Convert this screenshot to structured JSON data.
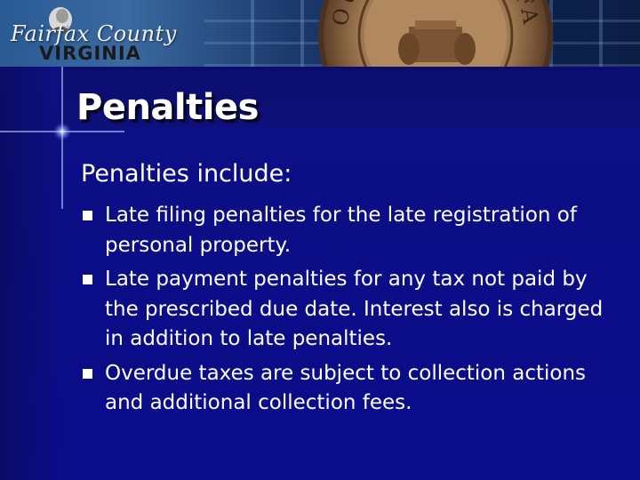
{
  "header": {
    "logo": {
      "line1": "Fairfax County",
      "line2": "VIRGINIA"
    },
    "seal_text": "COUNTY OF FAIRFAX"
  },
  "slide": {
    "title": "Penalties",
    "intro": "Penalties include:",
    "bullets": [
      {
        "text": "Late filing penalties for the late registration of personal property."
      },
      {
        "text": "Late payment penalties for any tax not paid by the prescribed due date. Interest also is charged in addition to late penalties."
      },
      {
        "text": "Overdue taxes are subject to collection actions and additional collection fees."
      }
    ]
  },
  "colors": {
    "background": "#0c0e86",
    "text": "#ffffff",
    "banner": "#2a5a94"
  }
}
